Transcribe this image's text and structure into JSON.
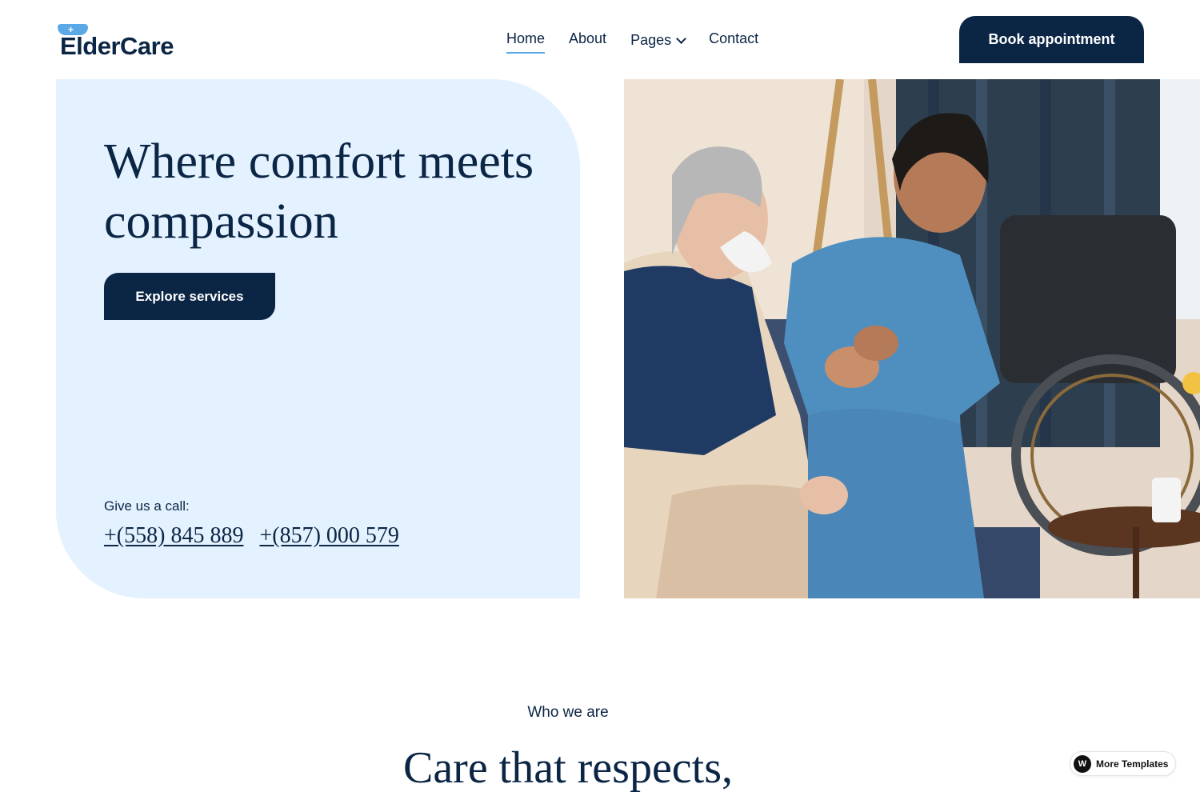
{
  "brand": {
    "name": "ElderCare",
    "primary_color": "#0b2545",
    "accent_color": "#5aa9e6",
    "hero_bg_color": "#e3f2fe"
  },
  "nav": {
    "items": [
      {
        "label": "Home",
        "active": true
      },
      {
        "label": "About",
        "active": false
      },
      {
        "label": "Pages",
        "active": false,
        "dropdown": true
      },
      {
        "label": "Contact",
        "active": false
      }
    ],
    "cta_label": "Book appointment"
  },
  "hero": {
    "title": "Where comfort meets compassion",
    "button_label": "Explore services",
    "call_label": "Give us a call:",
    "phones": [
      "+(558) 845 889",
      "+(857) 000 579"
    ],
    "image_icon": "caregiver-with-senior-photo"
  },
  "about": {
    "eyebrow": "Who we are",
    "title": "Care that respects,"
  },
  "badge": {
    "label": "More Templates",
    "icon": "webflow-icon"
  }
}
